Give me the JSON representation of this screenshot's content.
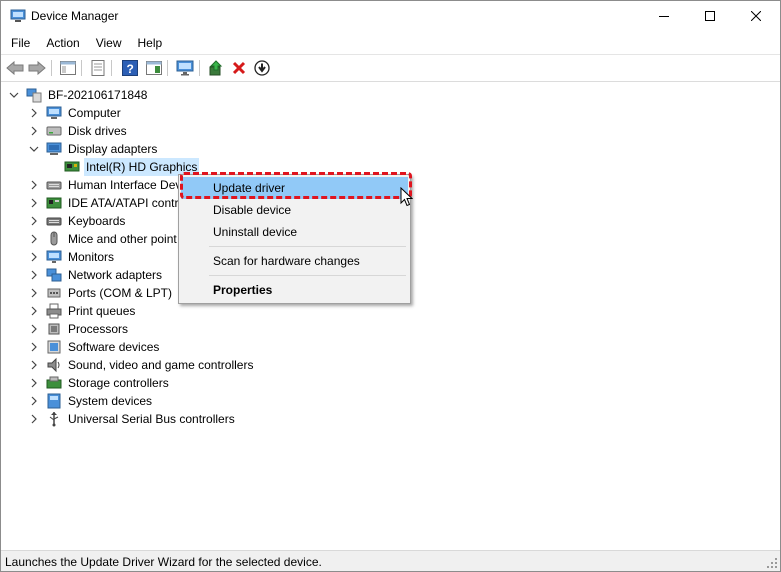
{
  "window": {
    "title": "Device Manager"
  },
  "menubar": [
    "File",
    "Action",
    "View",
    "Help"
  ],
  "toolbar": [
    "back-arrow-icon",
    "forward-arrow-icon",
    "show-hide-console-tree-icon",
    "properties-icon",
    "help-icon",
    "action-pane-icon",
    "monitor-icon",
    "update-driver-icon",
    "uninstall-x-icon",
    "enable-device-icon"
  ],
  "tree": {
    "root": "BF-202106171848",
    "items": [
      {
        "label": "Computer",
        "icon": "computer-icon",
        "expanded": false
      },
      {
        "label": "Disk drives",
        "icon": "disk-drive-icon",
        "expanded": false
      },
      {
        "label": "Display adapters",
        "icon": "display-adapter-icon",
        "expanded": true
      },
      {
        "label": "Intel(R) HD Graphics",
        "icon": "display-card-icon",
        "child": true,
        "selected": true
      },
      {
        "label": "Human Interface Dev",
        "icon": "hid-icon",
        "expanded": false
      },
      {
        "label": "IDE ATA/ATAPI contro",
        "icon": "ide-controller-icon",
        "expanded": false
      },
      {
        "label": "Keyboards",
        "icon": "keyboard-icon",
        "expanded": false
      },
      {
        "label": "Mice and other point",
        "icon": "mouse-icon",
        "expanded": false
      },
      {
        "label": "Monitors",
        "icon": "monitor-icon",
        "expanded": false
      },
      {
        "label": "Network adapters",
        "icon": "network-adapter-icon",
        "expanded": false
      },
      {
        "label": "Ports (COM & LPT)",
        "icon": "port-icon",
        "expanded": false
      },
      {
        "label": "Print queues",
        "icon": "printer-icon",
        "expanded": false
      },
      {
        "label": "Processors",
        "icon": "processor-icon",
        "expanded": false
      },
      {
        "label": "Software devices",
        "icon": "software-device-icon",
        "expanded": false
      },
      {
        "label": "Sound, video and game controllers",
        "icon": "sound-icon",
        "expanded": false
      },
      {
        "label": "Storage controllers",
        "icon": "storage-controller-icon",
        "expanded": false
      },
      {
        "label": "System devices",
        "icon": "system-device-icon",
        "expanded": false
      },
      {
        "label": "Universal Serial Bus controllers",
        "icon": "usb-icon",
        "expanded": false
      }
    ]
  },
  "context_menu": {
    "items": [
      "Update driver",
      "Disable device",
      "Uninstall device",
      "Scan for hardware changes",
      "Properties"
    ],
    "highlighted": "Update driver",
    "default_item": "Properties"
  },
  "status": {
    "text": "Launches the Update Driver Wizard for the selected device."
  },
  "colors": {
    "selection": "#cce8ff",
    "menu_highlight": "#91c9f7",
    "callout": "#e0141e"
  }
}
